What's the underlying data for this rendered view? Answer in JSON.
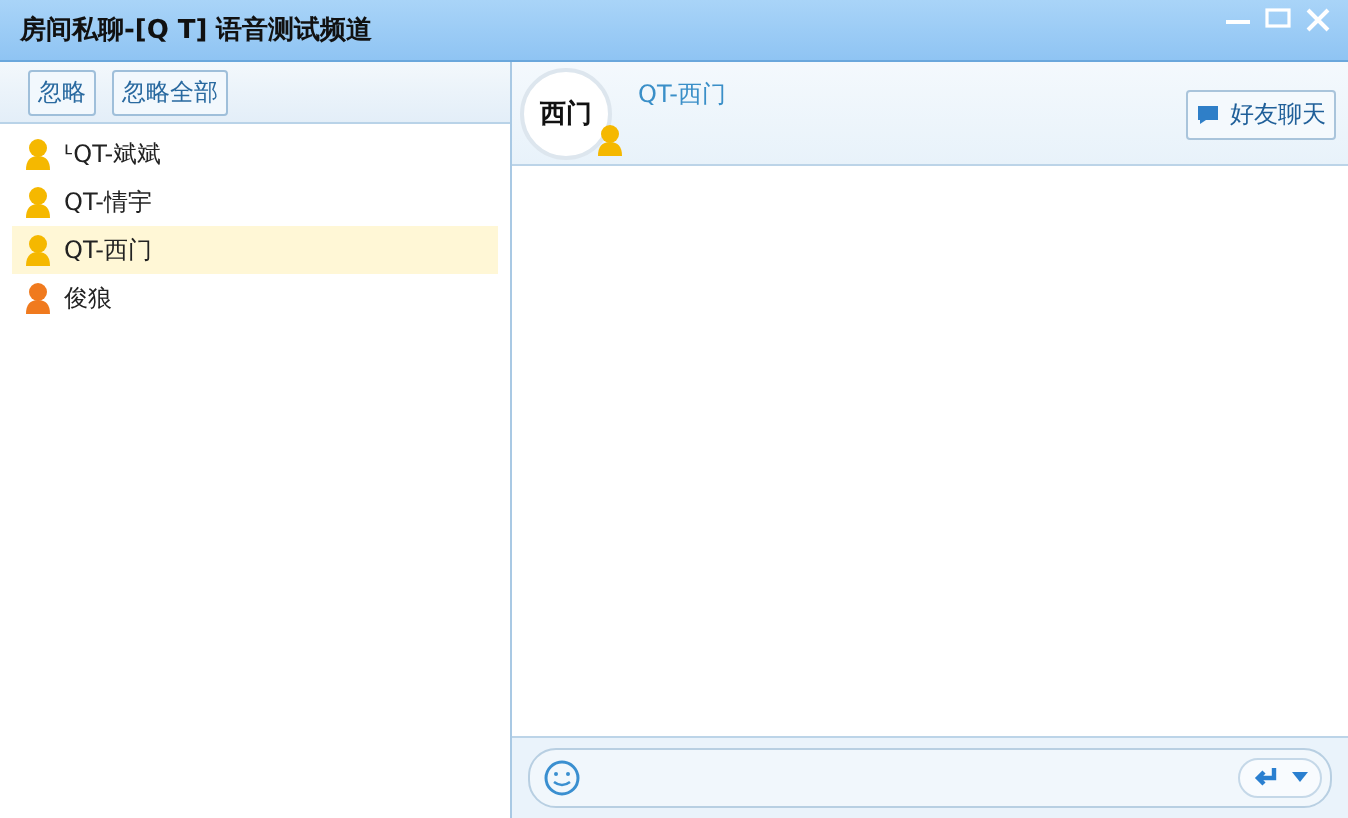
{
  "window": {
    "title": "房间私聊-[Q T] 语音测试频道"
  },
  "toolbar": {
    "buttons": [
      "忽略",
      "忽略全部"
    ]
  },
  "users": [
    {
      "name": "ᒻQT-斌斌",
      "color": "#f5b800",
      "selected": false
    },
    {
      "name": "QT-情宇",
      "color": "#f5b800",
      "selected": false
    },
    {
      "name": "QT-西门",
      "color": "#f5b800",
      "selected": true
    },
    {
      "name": "俊狼",
      "color": "#f07a1e",
      "selected": false
    }
  ],
  "chat": {
    "avatar_label": "西门",
    "name": "QT-西门",
    "friend_button": "好友聊天"
  }
}
